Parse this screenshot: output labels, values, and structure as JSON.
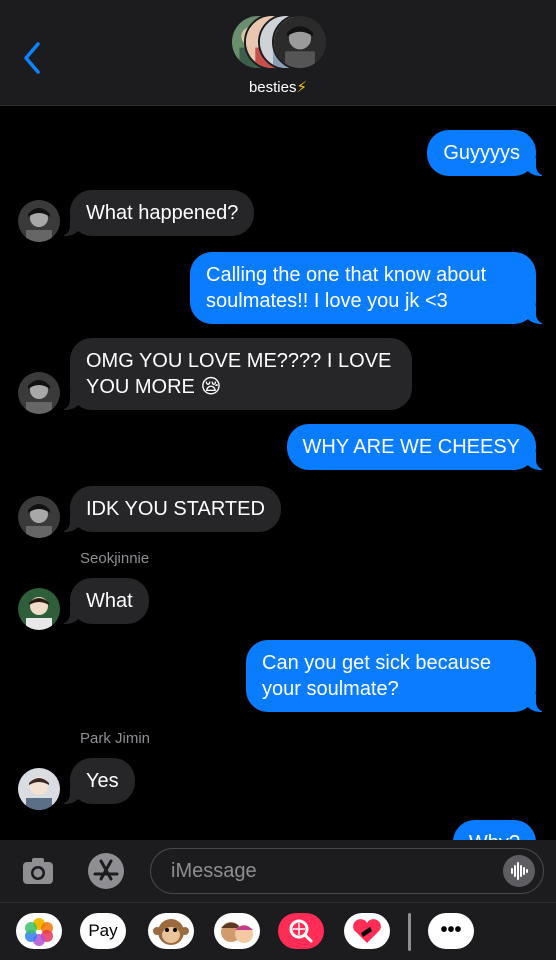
{
  "header": {
    "group_name": "besties",
    "bolt": "⚡",
    "back_icon": "chevron-left-icon"
  },
  "messages": [
    {
      "dir": "out",
      "text": "Guyyyys"
    },
    {
      "dir": "in",
      "text": "What happened?"
    },
    {
      "dir": "out",
      "text": "Calling the one that know about soulmates!! I love you jk <3"
    },
    {
      "dir": "in",
      "text": "OMG YOU LOVE ME???? I LOVE YOU MORE 😪"
    },
    {
      "dir": "out",
      "text": "WHY ARE WE CHEESY"
    },
    {
      "dir": "in",
      "text": "IDK YOU STARTED"
    },
    {
      "dir": "in",
      "sender": "Seokjinnie",
      "text": "What"
    },
    {
      "dir": "out",
      "text": "Can you get sick because your soulmate?"
    },
    {
      "dir": "in",
      "sender": "Park Jimin",
      "text": "Yes"
    },
    {
      "dir": "out",
      "text": "Why?"
    }
  ],
  "input": {
    "placeholder": "iMessage"
  },
  "apps": {
    "pay_label": "Pay",
    "more_label": "•••"
  },
  "colors": {
    "outgoing": "#0a7cff",
    "incoming": "#262629",
    "background": "#000000"
  }
}
